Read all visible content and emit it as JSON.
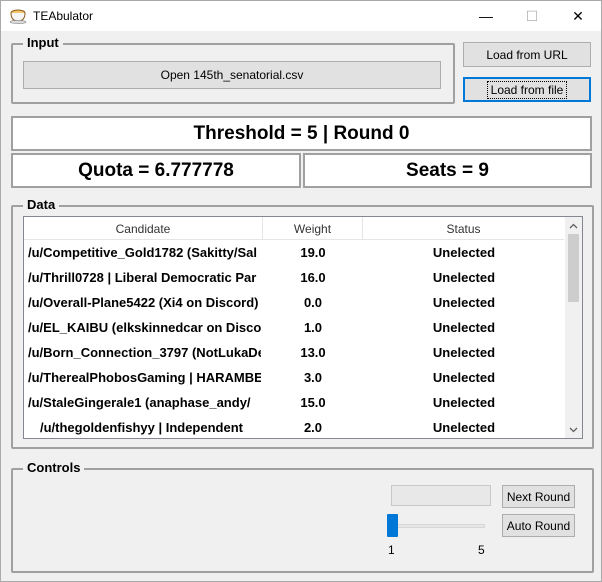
{
  "window": {
    "title": "TEAbulator",
    "minimize": "—",
    "maximize": "☐",
    "close": "✕"
  },
  "input_group": {
    "title": "Input",
    "open_button": "Open 145th_senatorial.csv"
  },
  "side_buttons": {
    "load_url": "Load from URL",
    "load_file": "Load from file"
  },
  "info": {
    "threshold_round": "Threshold = 5 | Round 0",
    "quota": "Quota = 6.777778",
    "seats": "Seats = 9"
  },
  "data_group": {
    "title": "Data",
    "columns": [
      "Candidate",
      "Weight",
      "Status"
    ],
    "rows": [
      {
        "candidate": "/u/Competitive_Gold1782 (Sakitty/Sal",
        "weight": "19.0",
        "status": "Unelected"
      },
      {
        "candidate": "/u/Thrill0728 | Liberal Democratic Par",
        "weight": "16.0",
        "status": "Unelected"
      },
      {
        "candidate": "/u/Overall-Plane5422 (Xi4 on Discord)",
        "weight": "0.0",
        "status": "Unelected"
      },
      {
        "candidate": "/u/EL_KAIBU (elkskinnedcar on Disco",
        "weight": "1.0",
        "status": "Unelected"
      },
      {
        "candidate": "/u/Born_Connection_3797 (NotLukaDe",
        "weight": "13.0",
        "status": "Unelected"
      },
      {
        "candidate": "/u/TherealPhobosGaming | HARAMBE",
        "weight": "3.0",
        "status": "Unelected"
      },
      {
        "candidate": "/u/StaleGingerale1 (anaphase_andy/",
        "weight": "15.0",
        "status": "Unelected"
      },
      {
        "candidate": "/u/thegoldenfishyy | Independent",
        "weight": "2.0",
        "status": "Unelected"
      }
    ]
  },
  "controls_group": {
    "title": "Controls",
    "next_round": "Next Round",
    "auto_round": "Auto Round",
    "slider": {
      "min": "1",
      "max": "5",
      "value": 1
    }
  },
  "colors": {
    "accent": "#0078d7",
    "border": "#a0a0a0",
    "button": "#e1e1e1"
  }
}
